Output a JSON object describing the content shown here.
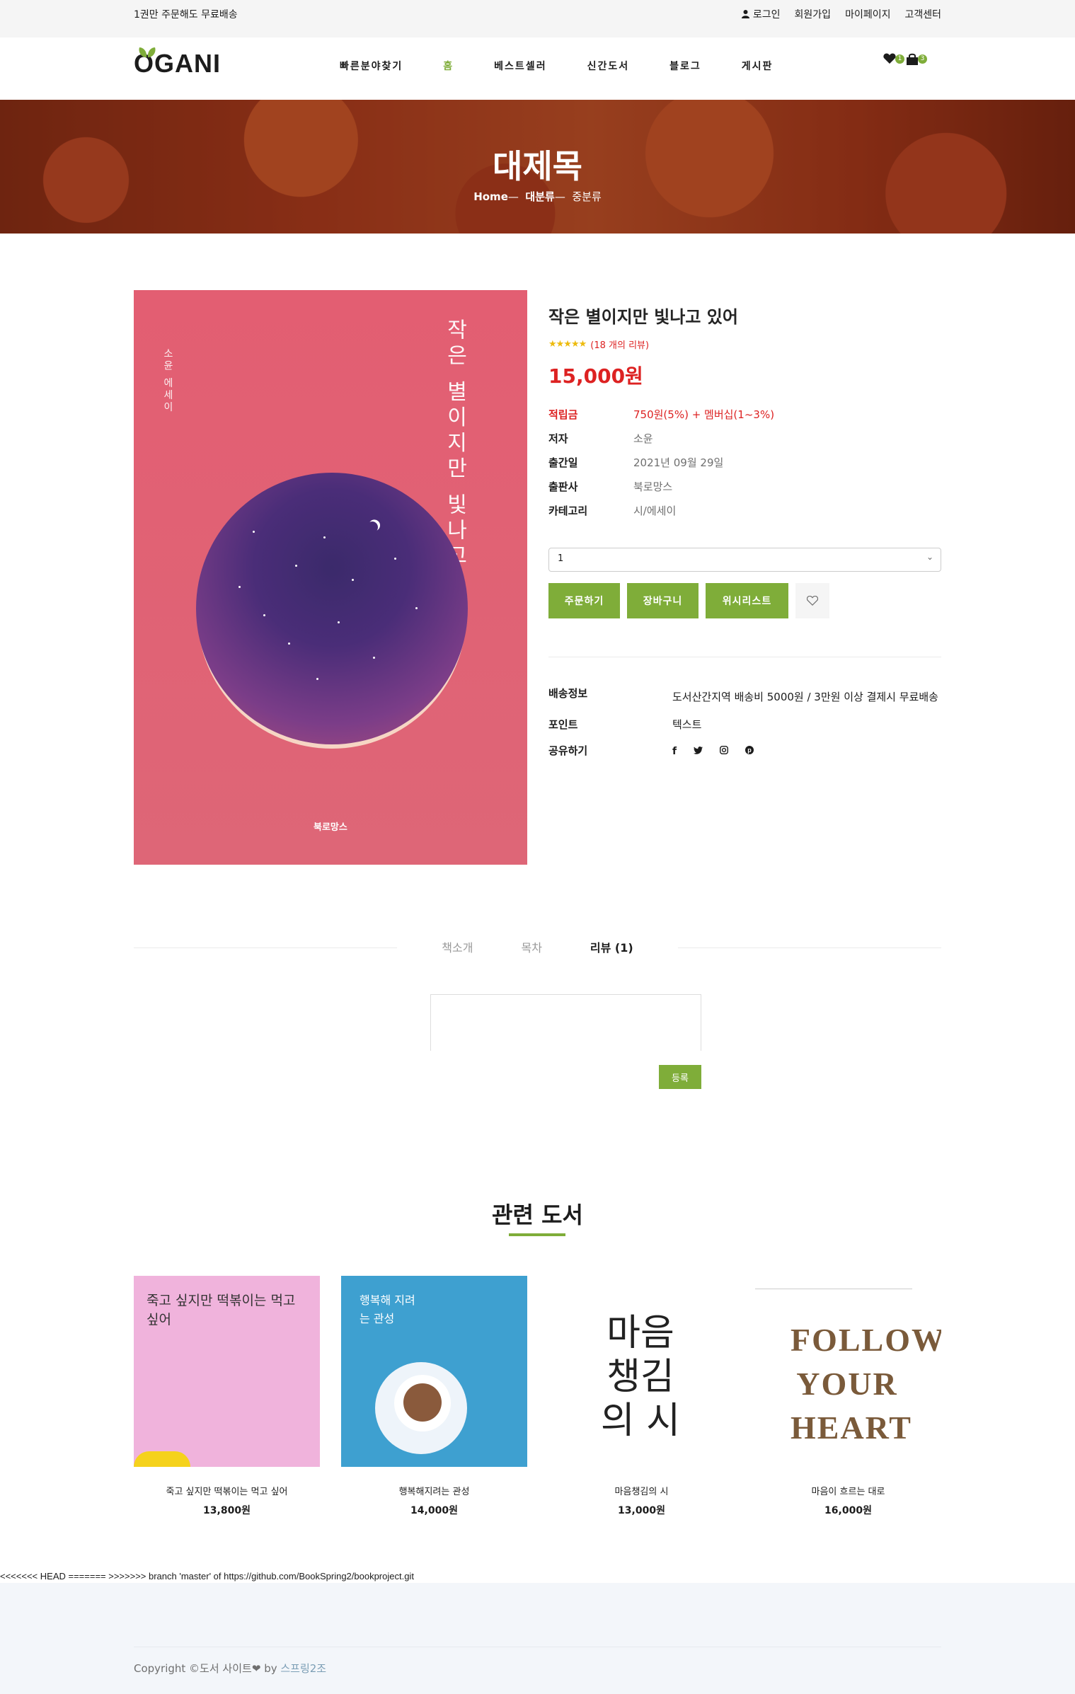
{
  "topbar": {
    "notice": "1권만 주문해도 무료배송",
    "links": [
      {
        "label": "로그인",
        "icon": "user-icon"
      },
      {
        "label": "회원가입"
      },
      {
        "label": "마이페이지"
      },
      {
        "label": "고객센터"
      }
    ]
  },
  "header": {
    "logo": "OGANI",
    "nav": [
      "빠른분야찾기",
      "홈",
      "베스트셀러",
      "신간도서",
      "블로그",
      "게시판"
    ],
    "active_nav": "홈",
    "wishlist_count": "1",
    "cart_count": "3"
  },
  "hero": {
    "title": "대제목",
    "breadcrumb": {
      "home": "Home",
      "level1": "대분류",
      "level2": "중분류"
    }
  },
  "product": {
    "title": "작은 별이지만 빛나고 있어",
    "cover": {
      "author_line": "소윤 에세이",
      "title_col1": "작은 별이지만",
      "title_col2": "빛나고 있어",
      "publisher": "북로망스"
    },
    "rating_text": "(18 개의 리뷰)",
    "price": "15,000원",
    "specs": [
      {
        "key": "적립금",
        "value": "750원(5%) + 멤버십(1~3%)"
      },
      {
        "key": "저자",
        "value": "소윤"
      },
      {
        "key": "출간일",
        "value": "2021년 09월 29일"
      },
      {
        "key": "출판사",
        "value": "북로망스"
      },
      {
        "key": "카테고리",
        "value": "시/에세이"
      }
    ],
    "quantity": "1",
    "buttons": {
      "order": "주문하기",
      "cart": "장바구니",
      "wishlist": "위시리스트"
    },
    "shipping": {
      "label": "배송정보",
      "value": "도서산간지역 배송비 5000원 / 3만원 이상 결제시 무료배송",
      "point_label": "포인트",
      "point_value": "텍스트",
      "share_label": "공유하기"
    }
  },
  "tabs": {
    "intro": "책소개",
    "toc": "목차",
    "review": "리뷰 (1)"
  },
  "review_form": {
    "submit": "등록"
  },
  "related": {
    "title": "관련 도서",
    "items": [
      {
        "name": "죽고 싶지만 떡볶이는 먹고 싶어",
        "price": "13,800원",
        "cover_text": "죽고 싶지만 떡볶이는 먹고 싶어"
      },
      {
        "name": "행복해지려는 관성",
        "price": "14,000원",
        "cover_text": "행복해 지려는 관성"
      },
      {
        "name": "마음챙김의 시",
        "price": "13,000원",
        "cover_text": "마음 챙김의 시"
      },
      {
        "name": "마음이 흐르는 대로",
        "price": "16,000원",
        "cover_text": "FOLLOW YOUR HEART"
      }
    ]
  },
  "merge_text": "<<<<<<< HEAD ======= >>>>>>> branch 'master' of https://github.com/BookSpring2/bookproject.git",
  "footer": {
    "copyright": "Copyright ©도서 사이트",
    "by": " by ",
    "team": "스프링2조"
  },
  "colors": {
    "accent": "#7fad39",
    "price": "#dd2222",
    "star": "#edbb0e"
  }
}
